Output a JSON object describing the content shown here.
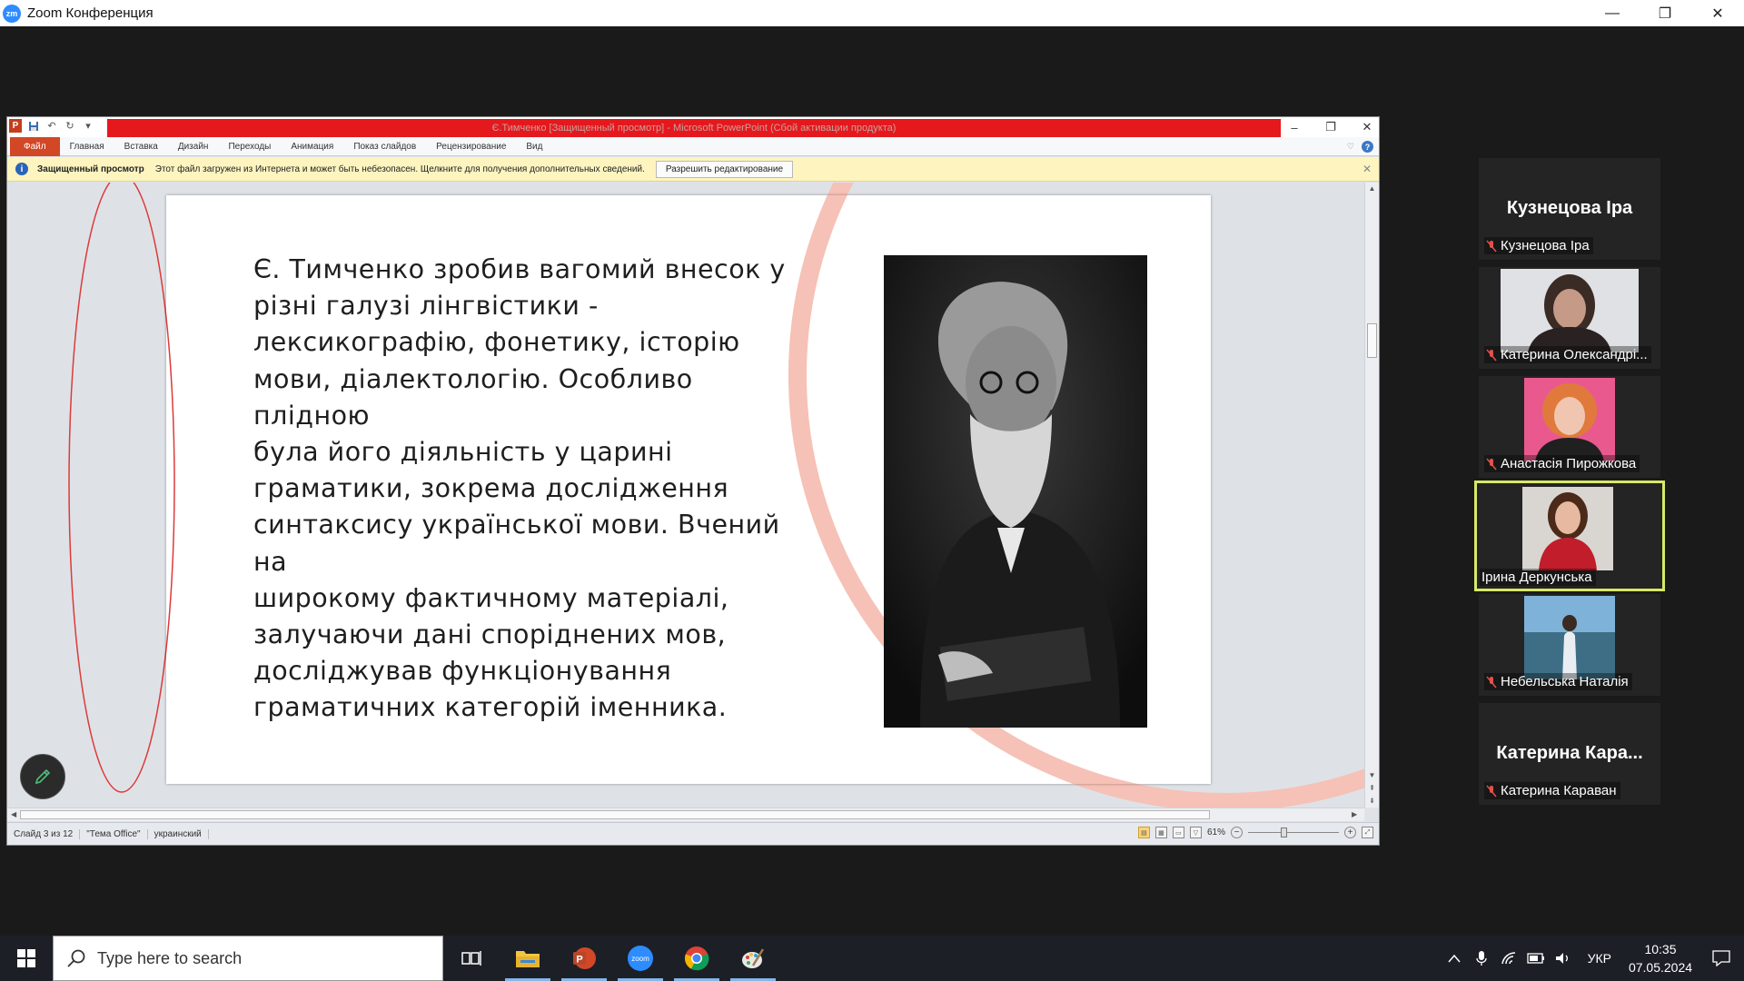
{
  "zoom": {
    "window_title": "Zoom Конференция",
    "controls": {
      "minimize": "—",
      "restore": "❐",
      "close": "✕"
    }
  },
  "powerpoint": {
    "title": "Є.Тимченко [Защищенный просмотр] - Microsoft PowerPoint (Сбой активации продукта)",
    "ribbon_tabs": [
      "Файл",
      "Главная",
      "Вставка",
      "Дизайн",
      "Переходы",
      "Анимация",
      "Показ слайдов",
      "Рецензирование",
      "Вид"
    ],
    "message_bar": {
      "title": "Защищенный просмотр",
      "text": "Этот файл загружен из Интернета и может быть небезопасен. Щелкните для получения дополнительных сведений.",
      "button": "Разрешить редактирование"
    },
    "slide": {
      "lines": [
        "Є. Тимченко зробив вагомий внесок у",
        "різні галузі лінгвістики -",
        "лексикографію, фонетику, історію",
        "мови, діалектологію. Особливо плідною",
        "була його діяльність у царині",
        "граматики, зокрема дослідження",
        "синтаксису української мови. Вчений на",
        "широкому фактичному матеріалі,",
        "залучаючи дані споріднених мов,",
        "досліджував функціонування",
        "граматичних категорій іменника."
      ]
    },
    "status": {
      "slide": "Слайд 3 из 12",
      "theme": "\"Тема Office\"",
      "language": "украинский",
      "zoom": "61%"
    }
  },
  "participants": [
    {
      "name": "Кузнецова Іра",
      "label": "Кузнецова Іра",
      "video": false,
      "speaking": false
    },
    {
      "name": "Катерина Олександрі...",
      "label": "Катерина Олександрі...",
      "video": true,
      "speaking": false
    },
    {
      "name": "Анастасія Пирожкова",
      "label": "Анастасія Пирожкова",
      "video": true,
      "speaking": false
    },
    {
      "name": "Ірина Деркунська",
      "label": "Ірина Деркунська",
      "video": true,
      "speaking": true
    },
    {
      "name": "Небельська Наталія",
      "label": "Небельська Наталія",
      "video": true,
      "speaking": false
    },
    {
      "name": "Катерина Кара...",
      "label": "Катерина Караван",
      "video": false,
      "speaking": false
    }
  ],
  "taskbar": {
    "search_placeholder": "Type here to search",
    "language": "УКР",
    "time": "10:35",
    "date": "07.05.2024",
    "apps": [
      "task-view-icon",
      "file-explorer-icon",
      "powerpoint-icon",
      "zoom-icon",
      "chrome-icon",
      "paint-icon"
    ]
  },
  "colors": {
    "ppt_accent": "#d24726",
    "activation_bar": "#e5181d",
    "speaker_border": "#d8e868",
    "zoom_blue": "#2d8cff"
  }
}
